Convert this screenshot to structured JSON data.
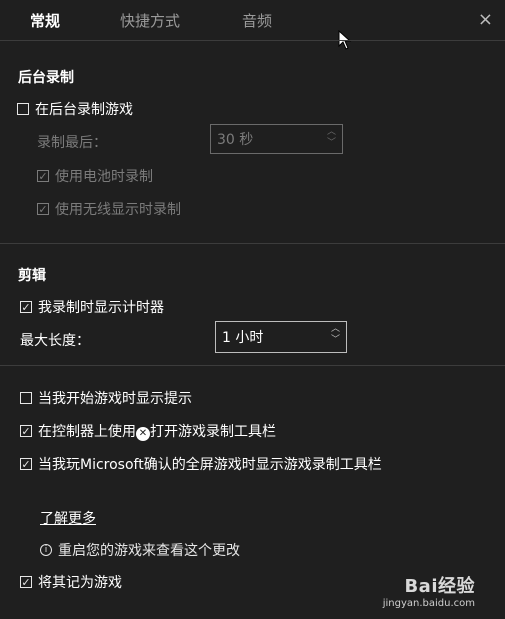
{
  "tabs": [
    "常规",
    "快捷方式",
    "音频"
  ],
  "close_glyph": "×",
  "sections": {
    "background_recording": {
      "title": "后台录制",
      "record_in_background": {
        "label": "在后台录制游戏",
        "checked": false
      },
      "record_last_label": "录制最后：",
      "record_last_value": "30 秒",
      "use_battery": {
        "label": "使用电池时录制",
        "checked": true
      },
      "use_wireless_display": {
        "label": "使用无线显示时录制",
        "checked": true
      }
    },
    "clips": {
      "title": "剪辑",
      "show_timer": {
        "label": "我录制时显示计时器",
        "checked": true
      },
      "max_length_label": "最大长度：",
      "max_length_value": "1 小时"
    }
  },
  "options": {
    "show_tips": {
      "label": "当我开始游戏时显示提示",
      "checked": false
    },
    "open_with_controller": {
      "label_before": "在控制器上使用",
      "label_after": "打开游戏录制工具栏",
      "checked": true
    },
    "fullscreen_toolbar": {
      "label": "当我玩Microsoft确认的全屏游戏时显示游戏录制工具栏",
      "checked": true
    }
  },
  "learn_more": "了解更多",
  "restart_notice": "重启您的游戏来查看这个更改",
  "remember_as_game": {
    "label": "将其记为游戏",
    "checked": true
  },
  "watermark": {
    "main": "Bai经验",
    "sub": "jingyan.baidu.com"
  }
}
